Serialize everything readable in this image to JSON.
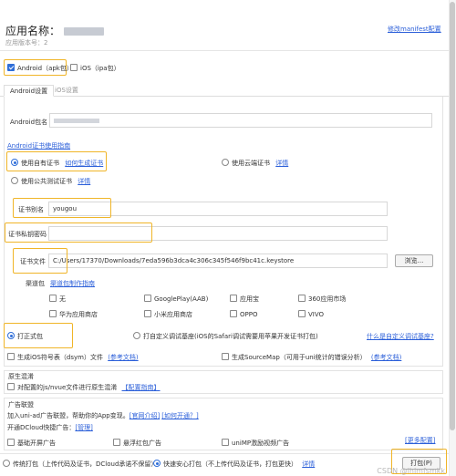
{
  "app": {
    "name_label": "应用名称：",
    "version_label": "应用版本号：2",
    "manifest_link": "修改manifest配置"
  },
  "platforms": {
    "android": "Android（apk包）",
    "ios": "iOS（ipa包）"
  },
  "tabs": {
    "android": "Android设置",
    "ios": "iOS设置"
  },
  "android": {
    "package_label": "Android包名",
    "cert_guide_link": "Android证书使用指南",
    "own_cert": "使用自有证书",
    "how_gen_link": "如何生成证书",
    "cloud_cert": "使用云端证书",
    "cloud_detail": "详情",
    "public_cert": "使用公共测试证书",
    "public_detail": "详情",
    "alias_label": "证书别名",
    "alias_value": "yougou",
    "pwd_label": "证书私钥密码",
    "file_label": "证书文件",
    "file_value": "C:/Users/17370/Downloads/7eda596b3dca4c306c345f546f9bc41c.keystore",
    "browse": "浏览...",
    "channel_label": "渠道包",
    "channel_guide": "渠道包制作指南",
    "channels": [
      "无",
      "GooglePlay(AAB)",
      "应用宝",
      "360应用市场",
      "华为应用商店",
      "小米应用商店",
      "OPPO",
      "VIVO"
    ]
  },
  "build": {
    "formal": "打正式包",
    "custom": "打自定义调试基座(iOS的Safari调试需要用苹果开发证书打包)",
    "custom_link": "什么是自定义调试基座?",
    "dsym": "生成iOS符号表（dsym）文件",
    "dsym_link": "(参考文档)",
    "sourcemap": "生成SourceMap（可用于uni统计的错误分析）",
    "sourcemap_link": "(参考文档)"
  },
  "native": {
    "title": "原生混淆",
    "option": "对配置的js/nvue文件进行原生混淆",
    "link": "【配置指南】"
  },
  "ads": {
    "title": "广告联盟",
    "line1": "加入uni-ad广告联盟，帮助你的App变现。",
    "line1_link1": "[官网介绍]",
    "line1_link2": "[如何开通？]",
    "line2": "开通DCloud快捷广告：",
    "line2_link": "[管理]",
    "more": "[更多配置]",
    "splash": "基础开屏广告",
    "redpack": "悬浮红包广告",
    "video": "uniMP激励视频广告"
  },
  "footer": {
    "traditional": "传统打包（上传代码及证书，DCloud承诺不保留）",
    "safe": "快速安心打包（不上传代码及证书，打包更快）",
    "detail": "详情",
    "pack_btn": "打包(P)"
  },
  "watermark": "CSDN @lhimfsmkk"
}
